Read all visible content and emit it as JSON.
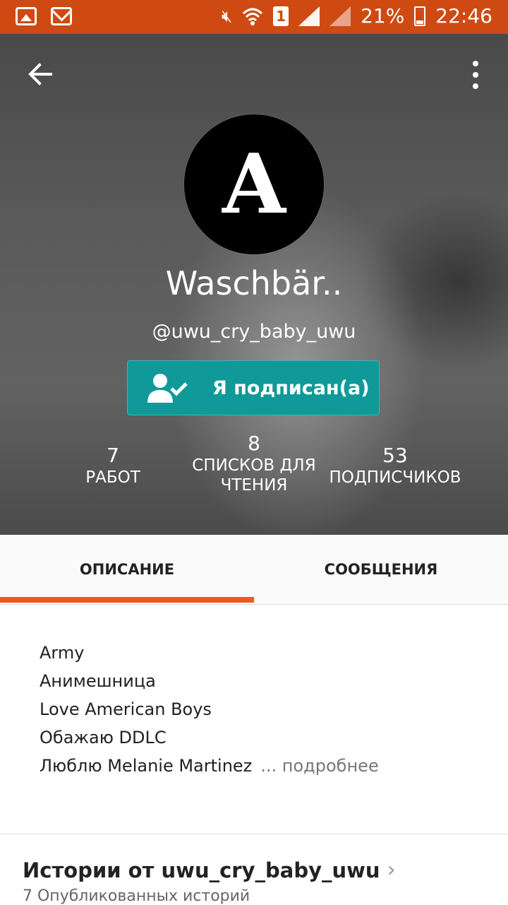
{
  "status_bar": {
    "battery": "21%",
    "time": "22:46",
    "sim_slot": "1",
    "icons": [
      "gallery-icon",
      "mail-icon",
      "mute-icon",
      "wifi-icon",
      "sim-icon",
      "signal-icon",
      "signal-icon",
      "battery-icon"
    ]
  },
  "colors": {
    "status_bar": "#cf4a13",
    "accent_teal": "#0f9a99",
    "tab_indicator": "#f05a17"
  },
  "profile": {
    "avatar_letter": "A",
    "display_name": "Waschbär..",
    "username": "@uwu_cry_baby_uwu",
    "follow_button": "Я подписан(а)"
  },
  "stats": [
    {
      "value": "7",
      "label_lines": [
        "РАБОТ"
      ]
    },
    {
      "value": "8",
      "label_lines": [
        "СПИСКОВ ДЛЯ",
        "ЧТЕНИЯ"
      ]
    },
    {
      "value": "53",
      "label_lines": [
        "ПОДПИСЧИКОВ"
      ]
    }
  ],
  "tabs": [
    {
      "label": "ОПИСАНИЕ",
      "selected": true
    },
    {
      "label": "СООБЩЕНИЯ",
      "selected": false
    }
  ],
  "description": {
    "lines": [
      "Army",
      "Анимешница",
      "Love American Boys",
      "Обажаю DDLC",
      "Люблю Melanie Martinez"
    ],
    "more_link": "... подробнее"
  },
  "stories": {
    "title": "Истории от uwu_cry_baby_uwu",
    "subtitle": "7 Опубликованных историй"
  }
}
